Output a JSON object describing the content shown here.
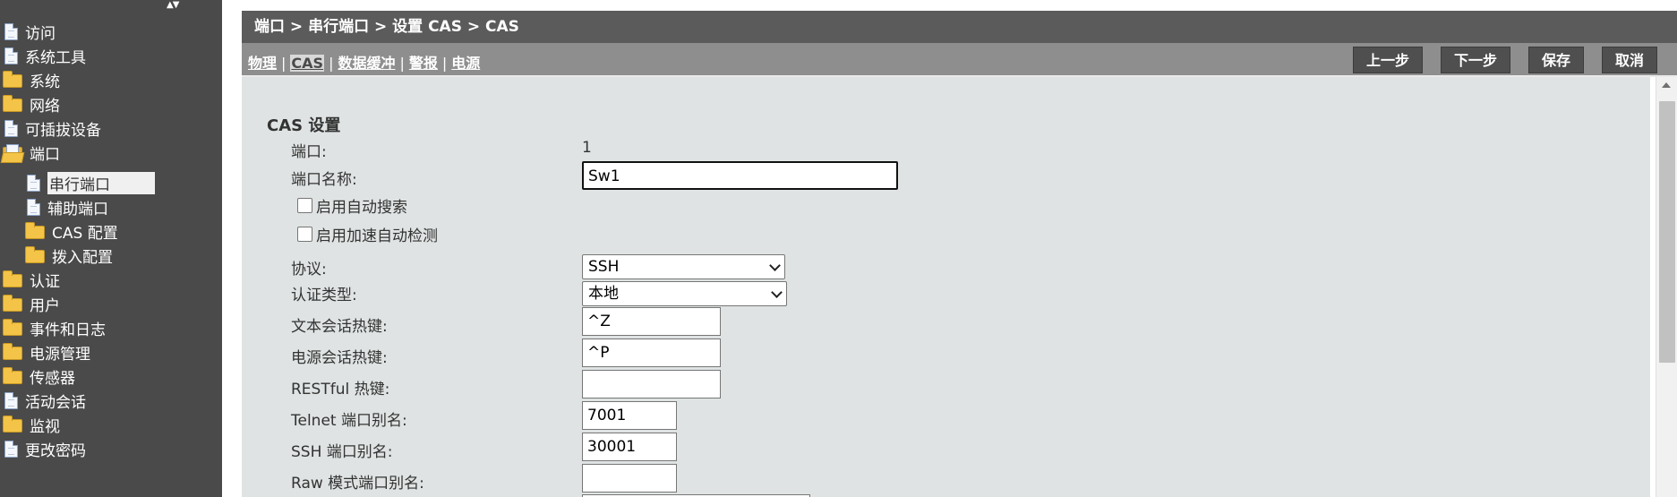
{
  "sidebar": {
    "items": [
      {
        "label": "访问",
        "icon": "document-icon"
      },
      {
        "label": "系统工具",
        "icon": "document-icon"
      },
      {
        "label": "系统",
        "icon": "folder-icon"
      },
      {
        "label": "网络",
        "icon": "folder-icon"
      },
      {
        "label": "可插拔设备",
        "icon": "document-icon"
      },
      {
        "label": "端口",
        "icon": "folder-open-icon"
      },
      {
        "label": "串行端口",
        "icon": "document-icon"
      },
      {
        "label": "辅助端口",
        "icon": "document-icon"
      },
      {
        "label": "CAS 配置",
        "icon": "folder-icon"
      },
      {
        "label": "拨入配置",
        "icon": "folder-icon"
      },
      {
        "label": "认证",
        "icon": "folder-icon"
      },
      {
        "label": "用户",
        "icon": "folder-icon"
      },
      {
        "label": "事件和日志",
        "icon": "folder-icon"
      },
      {
        "label": "电源管理",
        "icon": "folder-icon"
      },
      {
        "label": "传感器",
        "icon": "folder-icon"
      },
      {
        "label": "活动会话",
        "icon": "document-icon"
      },
      {
        "label": "监视",
        "icon": "folder-icon"
      },
      {
        "label": "更改密码",
        "icon": "document-icon"
      }
    ]
  },
  "header": {
    "breadcrumb": "端口 > 串行端口 > 设置 CAS > CAS"
  },
  "tabs": [
    {
      "label": "物理"
    },
    {
      "label": "CAS"
    },
    {
      "label": "数据缓冲"
    },
    {
      "label": "警报"
    },
    {
      "label": "电源"
    }
  ],
  "toolbar": {
    "prev_label": "上一步",
    "next_label": "下一步",
    "save_label": "保存",
    "cancel_label": "取消"
  },
  "form": {
    "section_title": "CAS 设置",
    "port_label": "端口:",
    "port_value": "1",
    "port_name_label": "端口名称:",
    "port_name_value": "Sw1",
    "auto_discovery_label": "启用自动搜索",
    "speed_auto_detect_label": "启用加速自动检测",
    "protocol_label": "协议:",
    "protocol_value": "SSH",
    "auth_type_label": "认证类型:",
    "auth_type_value": "本地",
    "text_hotkey_label": "文本会话热键:",
    "text_hotkey_value": "^Z",
    "power_hotkey_label": "电源会话热键:",
    "power_hotkey_value": "^P",
    "restful_hotkey_label": "RESTful 热键:",
    "restful_hotkey_value": "",
    "telnet_alias_label": "Telnet 端口别名:",
    "telnet_alias_value": "7001",
    "ssh_alias_label": "SSH 端口别名:",
    "ssh_alias_value": "30001",
    "raw_alias_label": "Raw 模式端口别名:",
    "raw_alias_value": ""
  },
  "colors": {
    "sidebar_bg": "#4a4a4a",
    "titlebar_bg": "#5b5b5b",
    "navbar_bg": "#8e8e8e",
    "content_bg": "#dfe3e3",
    "button_bg": "#4f4f4f"
  }
}
